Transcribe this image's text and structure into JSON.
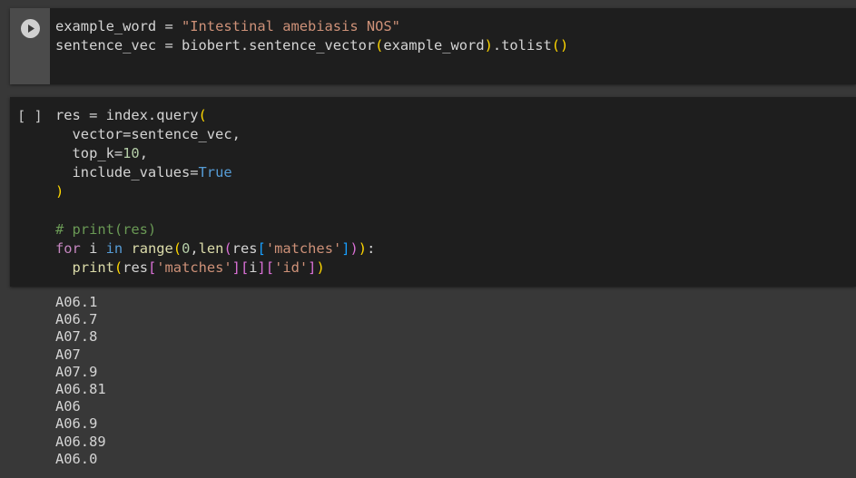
{
  "colors": {
    "page_bg": "#383838",
    "cell_bg": "#1e1e1e",
    "gutter_bg": "#4b4b4b"
  },
  "cell1": {
    "run_icon": "play-circle-icon",
    "lines": [
      [
        [
          "example_word = ",
          "def"
        ],
        [
          "\"Intestinal amebiasis NOS\"",
          "str"
        ]
      ],
      [
        [
          "sentence_vec = biobert.sentence_vector",
          "def"
        ],
        [
          "(",
          "b1"
        ],
        [
          "example_word",
          "def"
        ],
        [
          ")",
          "b1"
        ],
        [
          ".tolist",
          "def"
        ],
        [
          "()",
          "b1"
        ]
      ]
    ]
  },
  "cell2": {
    "execution_label": "[ ]",
    "lines": [
      [
        [
          "res = index.query",
          "def"
        ],
        [
          "(",
          "b1"
        ]
      ],
      [
        [
          "  vector=sentence_vec,",
          "def"
        ]
      ],
      [
        [
          "  top_k=",
          "def"
        ],
        [
          "10",
          "num"
        ],
        [
          ",",
          "def"
        ]
      ],
      [
        [
          "  include_values=",
          "def"
        ],
        [
          "True",
          "blue"
        ]
      ],
      [
        [
          ")",
          "b1"
        ]
      ],
      [
        [
          "",
          "def"
        ]
      ],
      [
        [
          "# print(res)",
          "cm"
        ]
      ],
      [
        [
          "for",
          "kw"
        ],
        [
          " i ",
          "def"
        ],
        [
          "in",
          "blue"
        ],
        [
          " ",
          "def"
        ],
        [
          "range",
          "fn"
        ],
        [
          "(",
          "b1"
        ],
        [
          "0",
          "num"
        ],
        [
          ",",
          "def"
        ],
        [
          "len",
          "fn"
        ],
        [
          "(",
          "b2"
        ],
        [
          "res",
          "def"
        ],
        [
          "[",
          "b3"
        ],
        [
          "'matches'",
          "str"
        ],
        [
          "]",
          "b3"
        ],
        [
          ")",
          "b2"
        ],
        [
          ")",
          "b1"
        ],
        [
          ":",
          "def"
        ]
      ],
      [
        [
          "  ",
          "def"
        ],
        [
          "print",
          "fn"
        ],
        [
          "(",
          "b1"
        ],
        [
          "res",
          "def"
        ],
        [
          "[",
          "b2"
        ],
        [
          "'matches'",
          "str"
        ],
        [
          "]",
          "b2"
        ],
        [
          "[",
          "b2"
        ],
        [
          "i",
          "def"
        ],
        [
          "]",
          "b2"
        ],
        [
          "[",
          "b2"
        ],
        [
          "'id'",
          "str"
        ],
        [
          "]",
          "b2"
        ],
        [
          ")",
          "b1"
        ]
      ]
    ]
  },
  "output": {
    "lines": [
      "A06.1",
      "A06.7",
      "A07.8",
      "A07",
      "A07.9",
      "A06.81",
      "A06",
      "A06.9",
      "A06.89",
      "A06.0"
    ]
  }
}
